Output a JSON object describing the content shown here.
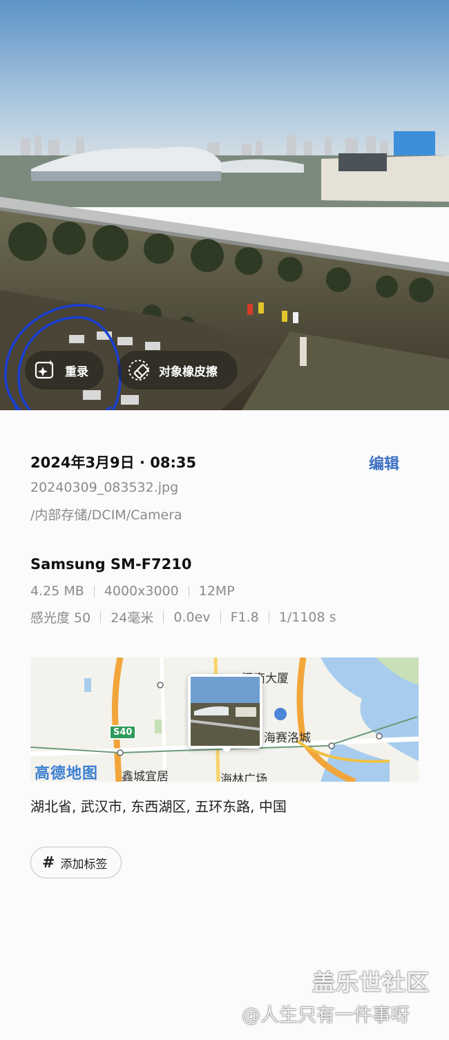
{
  "photo": {
    "actions": [
      {
        "label": "重录",
        "icon": "sparkle-frame-icon"
      },
      {
        "label": "对象橡皮擦",
        "icon": "eraser-icon"
      }
    ]
  },
  "details": {
    "datetime": "2024年3月9日 · 08:35",
    "edit_label": "编辑",
    "filename": "20240309_083532.jpg",
    "path": "/内部存储/DCIM/Camera",
    "device": "Samsung SM-F7210",
    "specs_row1": [
      "4.25 MB",
      "4000x3000",
      "12MP"
    ],
    "specs_row2": [
      "感光度 50",
      "24毫米",
      "0.0ev",
      "F1.8",
      "1/1108 s"
    ]
  },
  "map": {
    "provider_logo": "高德地图",
    "labels": [
      "汉商大厦",
      "海赛洛城",
      "鑫城宜居",
      "海林广场"
    ],
    "road_shield": "S40"
  },
  "address": "湖北省, 武汉市, 东西湖区, 五环东路, 中国",
  "tag_button_label": "添加标签",
  "watermark": {
    "line1": "盖乐世社区",
    "line2": "@人生只有一件事呀"
  },
  "colors": {
    "accent": "#3b6fc2",
    "secondary_text": "#8a8a8a",
    "background": "#fbfbfb"
  }
}
